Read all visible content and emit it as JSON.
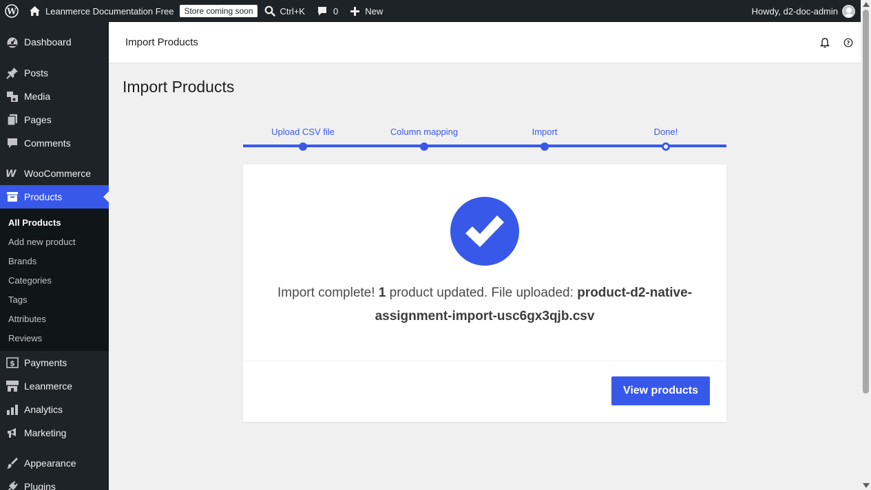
{
  "adminbar": {
    "site_name": "Leanmerce Documentation Free",
    "store_badge": "Store coming soon",
    "search_shortcut": "Ctrl+K",
    "comments_count": "0",
    "new_label": "New",
    "howdy": "Howdy, d2-doc-admin",
    "icons": [
      "wordpress-logo-icon",
      "home-icon",
      "search-icon",
      "comment-icon",
      "plus-icon",
      "avatar"
    ]
  },
  "sidebar": {
    "items": [
      {
        "label": "Dashboard",
        "icon": "dashboard-icon"
      },
      {
        "label": "Posts",
        "icon": "pin-icon"
      },
      {
        "label": "Media",
        "icon": "media-icon"
      },
      {
        "label": "Pages",
        "icon": "pages-icon"
      },
      {
        "label": "Comments",
        "icon": "comment-icon"
      },
      {
        "label": "WooCommerce",
        "icon": "woo-icon"
      },
      {
        "label": "Products",
        "icon": "archive-icon"
      },
      {
        "label": "Payments",
        "icon": "dollar-icon"
      },
      {
        "label": "Leanmerce",
        "icon": "store-icon"
      },
      {
        "label": "Analytics",
        "icon": "bar-chart-icon"
      },
      {
        "label": "Marketing",
        "icon": "megaphone-icon"
      },
      {
        "label": "Appearance",
        "icon": "brush-icon"
      },
      {
        "label": "Plugins",
        "icon": "plug-icon"
      }
    ],
    "products_submenu": [
      "All Products",
      "Add new product",
      "Brands",
      "Categories",
      "Tags",
      "Attributes",
      "Reviews"
    ]
  },
  "header": {
    "title": "Import Products",
    "icons": [
      "bell-icon",
      "help-icon"
    ]
  },
  "page": {
    "heading": "Import Products"
  },
  "stepper": {
    "steps": [
      "Upload CSV file",
      "Column mapping",
      "Import",
      "Done!"
    ]
  },
  "card": {
    "msg_prefix": "Import complete! ",
    "count": "1",
    "msg_mid": " product updated. File uploaded: ",
    "filename": "product-d2-native-assignment-import-usc6gx3qjb.csv",
    "button": "View products"
  },
  "colors": {
    "accent": "#3858e9",
    "adminbar_bg": "#1d2327",
    "content_bg": "#f0f0f1"
  }
}
